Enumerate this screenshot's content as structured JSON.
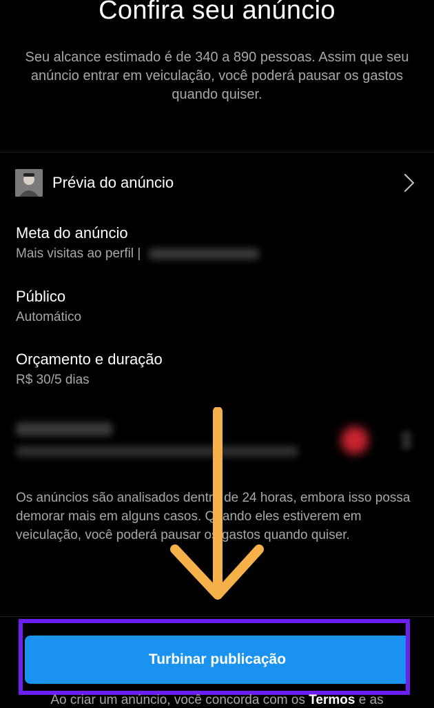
{
  "header": {
    "title": "Confira seu anúncio",
    "subtitle": "Seu alcance estimado é de 340 a 890 pessoas. Assim que seu anúncio entrar em veiculação, você poderá pausar os gastos quando quiser."
  },
  "preview": {
    "label": "Prévia do anúncio"
  },
  "sections": {
    "goal_title": "Meta do anúncio",
    "goal_value": "Mais visitas ao perfil |",
    "audience_title": "Público",
    "audience_value": "Automático",
    "budget_title": "Orçamento e duração",
    "budget_value": "R$ 30/5 dias"
  },
  "notice": "Os anúncios são analisados dentro de 24 horas, embora isso possa demorar mais em alguns casos. Quando eles estiverem em veiculação, você poderá pausar os gastos quando quiser.",
  "cta": {
    "label": "Turbinar publicação"
  },
  "footer": {
    "text_before": "Ao criar um anúncio, você concorda com os",
    "terms_link": "Termos",
    "text_after": "e as"
  },
  "colors": {
    "accent": "#1a93f0",
    "highlight": "#6d1ef0",
    "arrow": "#f6b14a"
  }
}
